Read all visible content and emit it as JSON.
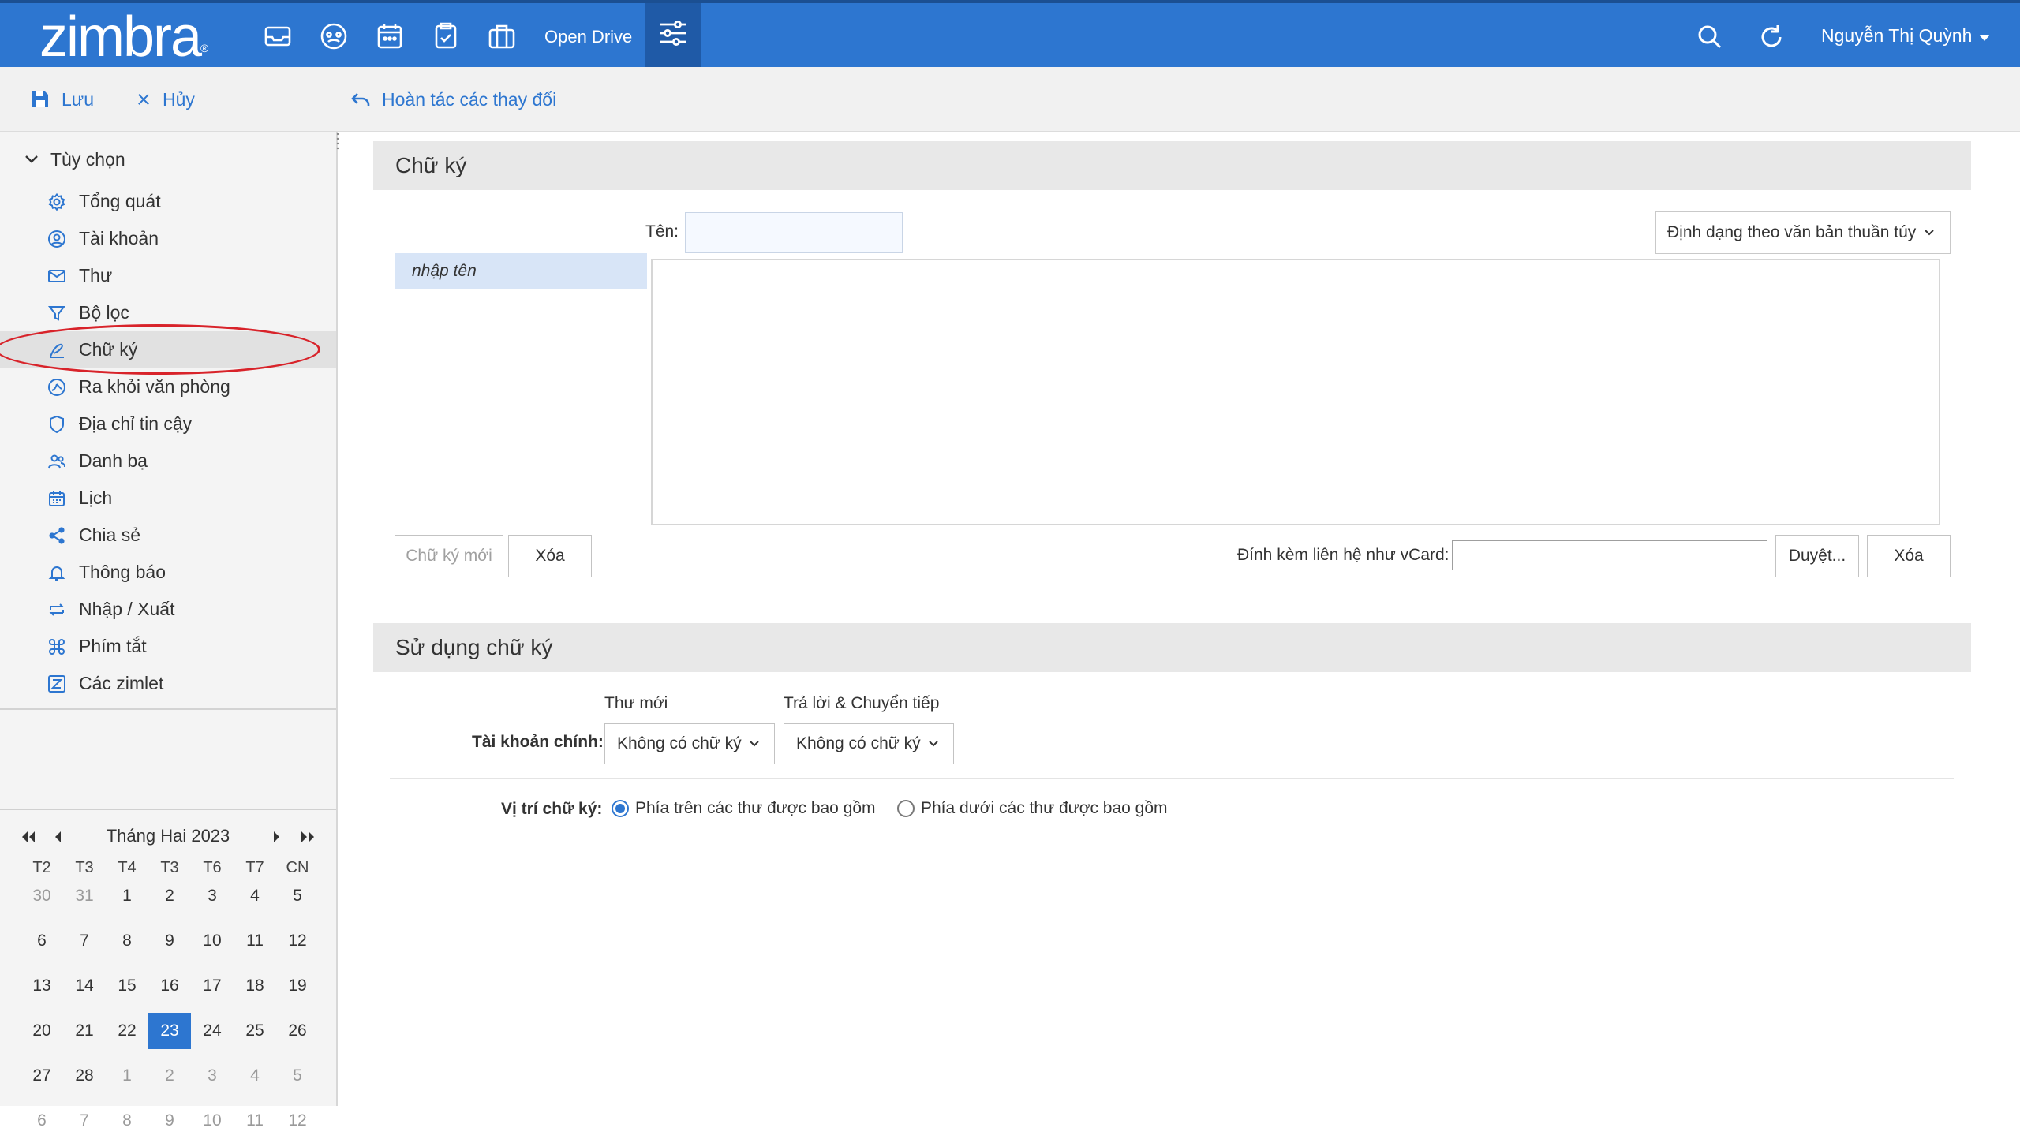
{
  "header": {
    "logo": "zimbra",
    "logo_mark": "®",
    "open_drive": "Open Drive",
    "user_name": "Nguyễn Thị Quỳnh"
  },
  "toolbar": {
    "save": "Lưu",
    "cancel": "Hủy",
    "revert": "Hoàn tác các thay đổi"
  },
  "nav": {
    "header": "Tùy chọn",
    "items": [
      {
        "label": "Tổng quát",
        "icon": "gear-icon"
      },
      {
        "label": "Tài khoản",
        "icon": "account-icon"
      },
      {
        "label": "Thư",
        "icon": "mail-icon"
      },
      {
        "label": "Bộ lọc",
        "icon": "filter-icon"
      },
      {
        "label": "Chữ ký",
        "icon": "signature-icon",
        "selected": true
      },
      {
        "label": "Ra khỏi văn phòng",
        "icon": "out-of-office-icon"
      },
      {
        "label": "Địa chỉ tin cậy",
        "icon": "shield-icon"
      },
      {
        "label": "Danh bạ",
        "icon": "contacts-icon"
      },
      {
        "label": "Lịch",
        "icon": "calendar-icon"
      },
      {
        "label": "Chia sẻ",
        "icon": "share-icon"
      },
      {
        "label": "Thông báo",
        "icon": "bell-icon"
      },
      {
        "label": "Nhập / Xuất",
        "icon": "import-export-icon"
      },
      {
        "label": "Phím tắt",
        "icon": "shortcut-icon"
      },
      {
        "label": "Các zimlet",
        "icon": "zimlet-icon"
      }
    ]
  },
  "calendar": {
    "title": "Tháng Hai 2023",
    "weekdays": [
      "T2",
      "T3",
      "T4",
      "T3",
      "T6",
      "T7",
      "CN"
    ],
    "weeks": [
      [
        "30",
        "31",
        "1",
        "2",
        "3",
        "4",
        "5"
      ],
      [
        "6",
        "7",
        "8",
        "9",
        "10",
        "11",
        "12"
      ],
      [
        "13",
        "14",
        "15",
        "16",
        "17",
        "18",
        "19"
      ],
      [
        "20",
        "21",
        "22",
        "23",
        "24",
        "25",
        "26"
      ],
      [
        "27",
        "28",
        "1",
        "2",
        "3",
        "4",
        "5"
      ],
      [
        "6",
        "7",
        "8",
        "9",
        "10",
        "11",
        "12"
      ]
    ],
    "today": "23"
  },
  "signature": {
    "section_title": "Chữ ký",
    "name_label": "Tên:",
    "name_value": "",
    "format_dropdown": "Định dạng theo văn bản thuần túy",
    "list_item": "nhập tên",
    "new_button": "Chữ ký mới",
    "delete_button": "Xóa",
    "vcard_label": "Đính kèm liên hệ như vCard:",
    "browse_button": "Duyệt...",
    "vcard_delete_button": "Xóa"
  },
  "usage": {
    "section_title": "Sử dụng chữ ký",
    "col_new": "Thư mới",
    "col_reply": "Trả lời & Chuyển tiếp",
    "account_label": "Tài khoản chính:",
    "new_value": "Không có chữ ký",
    "reply_value": "Không có chữ ký",
    "position_label": "Vị trí chữ ký:",
    "radio_above": "Phía trên các thư được bao gồm",
    "radio_below": "Phía dưới các thư được bao gồm",
    "selected": "above"
  },
  "colors": {
    "header_bg": "#2d76d0",
    "accent": "#2d76d0",
    "annotation": "#d8232a"
  }
}
